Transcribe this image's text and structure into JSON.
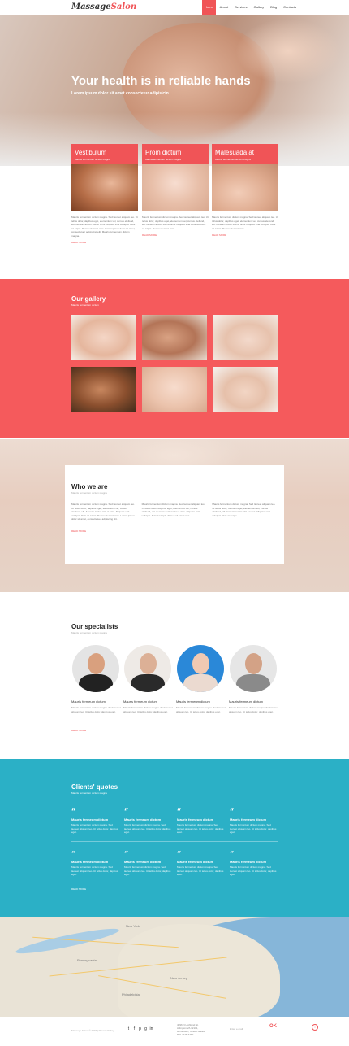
{
  "header": {
    "logo_part1": "Massage",
    "logo_part2": "Salon",
    "nav": [
      "Home",
      "About",
      "Services",
      "Gallery",
      "Blog",
      "Contacts"
    ]
  },
  "hero": {
    "title": "Your health is in reliable hands",
    "subtitle": "Lorem ipsum dolor sit amet consectetur adipisicin"
  },
  "services": [
    {
      "title": "Vestibulum",
      "sub": "Mauris fermentum dictum magna",
      "text": "Mauris fermentum dictum magna. Sed laoreet aliquam leo. Ut tellus dolor, dapibus eget, elementum vel, cursus eleifend, elit. Aenean auctor wisi et urna. Aliquam erat volutpat. Duis ac turpis. Donec sit amet eros. Lorem ipsum dolor sit amet, consectetuer adipiscing elit. Mauris fermentum dictum magna.",
      "more": "READ MORE"
    },
    {
      "title": "Proin dictum",
      "sub": "Mauris fermentum dictum magna",
      "text": "Mauris fermentum dictum magna. Sed laoreet aliquam leo. Ut tellus dolor, dapibus eget, elementum vel, cursus eleifend, elit. Aenean auctor wisi et urna. Aliquam erat volutpat. Duis ac turpis. Donec sit amet eros.",
      "more": "READ MORE"
    },
    {
      "title": "Malesuada at",
      "sub": "Mauris fermentum dictum magna",
      "text": "Mauris fermentum dictum magna. Sed laoreet aliquam leo. Ut tellus dolor, dapibus eget, elementum vel, cursus eleifend, elit. Aenean auctor wisi et urna. Aliquam erat volutpat. Duis ac turpis. Donec sit amet eros.",
      "more": "READ MORE"
    }
  ],
  "gallery": {
    "title": "Our gallery",
    "subtitle": "Mauris fermentum dictum"
  },
  "who": {
    "title": "Who we are",
    "subtitle": "Mauris fermentum dictum magna",
    "columns": [
      "Mauris fermentum dictum magna. Sed laoreet aliquam leo. Ut tellus dolor, dapibus eget, elementum vel, cursus eleifend, elit. Aenean auctor wisi et urna. Aliquam erat volutpat. Duis ac turpis. Donec sit amet eros. Lorem ipsum dolor sit amet, consectetuer adipiscing elit.",
      "Mauris fermentum dictum magna. Sed laoreet aliquam leo. Ut tellus dolor, dapibus eget, elementum vel, cursus eleifend, elit. Aenean auctor wisi et urna. Aliquam erat volutpat. Duis ac turpis. Donec sit amet eros.",
      "Mauris fermentum dictum magna. Sed laoreet aliquam leo. Ut tellus dolor, dapibus eget, elementum vel, cursus eleifend, elit. Aenean auctor wisi et urna. Aliquam erat volutpat. Duis ac turpis."
    ],
    "more": "READ MORE"
  },
  "specialists": {
    "title": "Our specialists",
    "subtitle": "Mauris fermentum dictum magna",
    "items": [
      {
        "name": "Mauris fermeum dictum",
        "text": "Mauris fermentum dictum magna. Sed laoreet aliquam leo. Ut tellus dolor, dapibus eget."
      },
      {
        "name": "Mauris fermeum dictum",
        "text": "Mauris fermentum dictum magna. Sed laoreet aliquam leo. Ut tellus dolor, dapibus eget."
      },
      {
        "name": "Mauris fermeum dictum",
        "text": "Mauris fermentum dictum magna. Sed laoreet aliquam leo. Ut tellus dolor, dapibus eget."
      },
      {
        "name": "Mauris fermeum dictum",
        "text": "Mauris fermentum dictum magna. Sed laoreet aliquam leo. Ut tellus dolor, dapibus eget."
      }
    ],
    "more": "READ MORE"
  },
  "quotes": {
    "title": "Clients' quotes",
    "subtitle": "Mauris fermentum dictum magna",
    "mark": "“",
    "items": [
      {
        "name": "Mauris fermeum dictum",
        "text": "Mauris fermentum dictum magna. Sed laoreet aliquam leo. Ut tellus dolor, dapibus eget."
      },
      {
        "name": "Mauris fermeum dictum",
        "text": "Mauris fermentum dictum magna. Sed laoreet aliquam leo. Ut tellus dolor, dapibus eget."
      },
      {
        "name": "Mauris fermeum dictum",
        "text": "Mauris fermentum dictum magna. Sed laoreet aliquam leo. Ut tellus dolor, dapibus eget."
      },
      {
        "name": "Mauris fermeum dictum",
        "text": "Mauris fermentum dictum magna. Sed laoreet aliquam leo. Ut tellus dolor, dapibus eget."
      },
      {
        "name": "Mauris fermeum dictum",
        "text": "Mauris fermentum dictum magna. Sed laoreet aliquam leo. Ut tellus dolor, dapibus eget."
      },
      {
        "name": "Mauris fermeum dictum",
        "text": "Mauris fermentum dictum magna. Sed laoreet aliquam leo. Ut tellus dolor, dapibus eget."
      },
      {
        "name": "Mauris fermeum dictum",
        "text": "Mauris fermentum dictum magna. Sed laoreet aliquam leo. Ut tellus dolor, dapibus eget."
      },
      {
        "name": "Mauris fermeum dictum",
        "text": "Mauris fermentum dictum magna. Sed laoreet aliquam leo. Ut tellus dolor, dapibus eget."
      }
    ],
    "more": "READ MORE"
  },
  "map": {
    "labels": [
      "New York",
      "Pennsylvania",
      "New Jersey",
      "Philadelphia"
    ]
  },
  "footer": {
    "copyright": "Massage Salon © 2015 | Privacy Policy",
    "address_lines": [
      "4096 N Highland St,",
      "Arlington VA 32101,",
      "Hometown, United States",
      "800-2345-6789"
    ],
    "newsletter_placeholder": "Enter e-mail",
    "ok_label": "OK",
    "social_icons": [
      "twitter-icon",
      "facebook-icon",
      "pinterest-icon",
      "google-plus-icon",
      "linkedin-icon"
    ],
    "to_top": "↑"
  },
  "colors": {
    "accent": "#f05457",
    "gallery_bg": "#f55a5c",
    "quotes_bg": "#2bb0c6"
  }
}
